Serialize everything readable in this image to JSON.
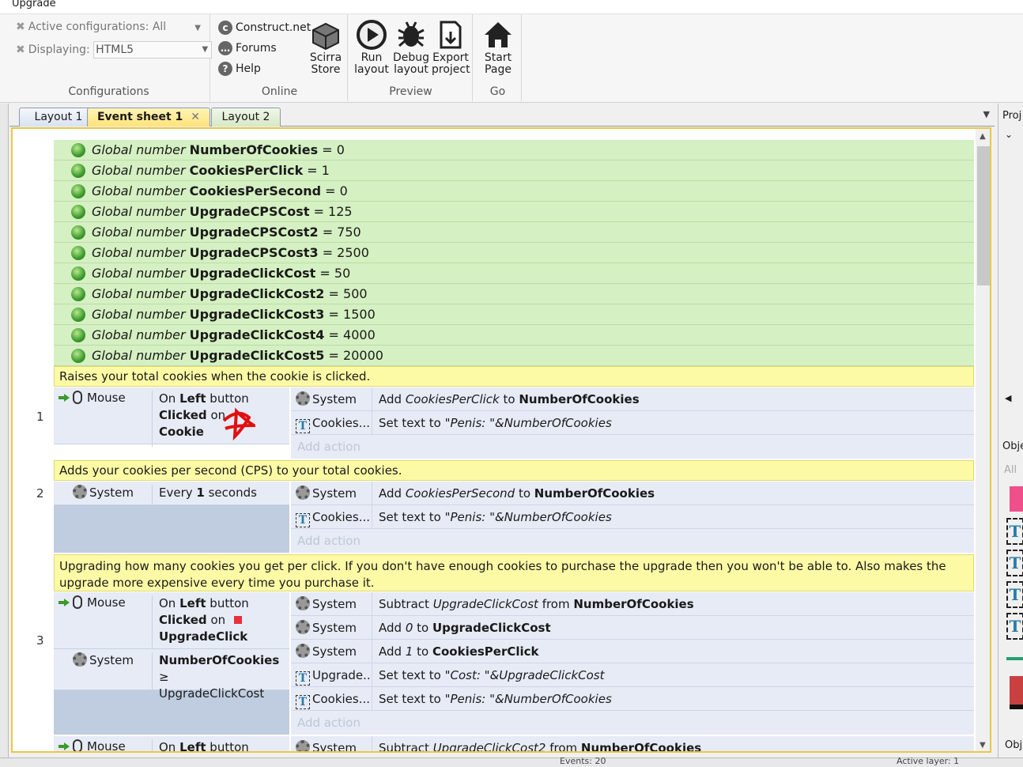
{
  "window": {
    "title": "Upgrade"
  },
  "ribbon": {
    "configurations": {
      "active_label": "Active configurations: All",
      "displaying_label": "Displaying:",
      "displaying_value": "HTML5",
      "group_label": "Configurations"
    },
    "online": {
      "construct": "Construct.net",
      "forums": "Forums",
      "help": "Help",
      "store_l1": "Scirra",
      "store_l2": "Store",
      "group_label": "Online"
    },
    "preview": {
      "run_l1": "Run",
      "run_l2": "layout",
      "debug_l1": "Debug",
      "debug_l2": "layout",
      "export_l1": "Export",
      "export_l2": "project",
      "group_label": "Preview"
    },
    "go": {
      "start_l1": "Start",
      "start_l2": "Page",
      "group_label": "Go"
    }
  },
  "tabs": {
    "layout1": "Layout 1",
    "event": "Event sheet 1",
    "close": "✕",
    "layout2": "Layout 2"
  },
  "globals": [
    {
      "kw": "Global number",
      "name": "NumberOfCookies",
      "value": "= 0"
    },
    {
      "kw": "Global number",
      "name": "CookiesPerClick",
      "value": "= 1"
    },
    {
      "kw": "Global number",
      "name": "CookiesPerSecond",
      "value": "= 0"
    },
    {
      "kw": "Global number",
      "name": "UpgradeCPSCost",
      "value": "= 125"
    },
    {
      "kw": "Global number",
      "name": "UpgradeCPSCost2",
      "value": "= 750"
    },
    {
      "kw": "Global number",
      "name": "UpgradeCPSCost3",
      "value": "= 2500"
    },
    {
      "kw": "Global number",
      "name": "UpgradeClickCost",
      "value": "= 50"
    },
    {
      "kw": "Global number",
      "name": "UpgradeClickCost2",
      "value": "= 500"
    },
    {
      "kw": "Global number",
      "name": "UpgradeClickCost3",
      "value": "= 1500"
    },
    {
      "kw": "Global number",
      "name": "UpgradeClickCost4",
      "value": "= 4000"
    },
    {
      "kw": "Global number",
      "name": "UpgradeClickCost5",
      "value": "= 20000"
    }
  ],
  "events": {
    "c1": "Raises your total cookies when the cookie is clicked.",
    "e1": {
      "num": "1",
      "cond_obj": "Mouse",
      "cond_a": "On ",
      "cond_b": "Left",
      "cond_c": " button",
      "cond_d": "Clicked",
      "cond_e": " on ",
      "cond_f": "Cookie",
      "a1_obj": "System",
      "a1_p1": "Add ",
      "a1_p2": "CookiesPerClick",
      "a1_p3": " to ",
      "a1_p4": "NumberOfCookies",
      "a2_obj": "Cookies...",
      "a2_p1": "Set text to ",
      "a2_p2": "\"Penis: \"&NumberOfCookies",
      "add": "Add action"
    },
    "c2": "Adds your cookies per second (CPS) to your total cookies.",
    "e2": {
      "num": "2",
      "cond_obj": "System",
      "cond_a": "Every ",
      "cond_b": "1",
      "cond_c": " seconds",
      "a1_obj": "System",
      "a1_p1": "Add ",
      "a1_p2": "CookiesPerSecond",
      "a1_p3": " to ",
      "a1_p4": "NumberOfCookies",
      "a2_obj": "Cookies...",
      "a2_p1": "Set text to ",
      "a2_p2": "\"Penis: \"&NumberOfCookies",
      "add": "Add action"
    },
    "c3": "Upgrading how many cookies you get per click. If you don't have enough cookies to purchase the upgrade then you won't be able to. Also makes the upgrade more expensive every time you purchase it.",
    "e3": {
      "num": "3",
      "cond1_obj": "Mouse",
      "cond1_a": "On ",
      "cond1_b": "Left",
      "cond1_c": " button",
      "cond1_d": "Clicked",
      "cond1_e": " on ",
      "cond1_f": "UpgradeClick",
      "cond2_obj": "System",
      "cond2_a": "NumberOfCookies",
      "cond2_b": " ≥",
      "cond2_c": "UpgradeClickCost",
      "a1_obj": "System",
      "a1_p1": "Subtract ",
      "a1_p2": "UpgradeClickCost",
      "a1_p3": " from ",
      "a1_p4": "NumberOfCookies",
      "a2_obj": "System",
      "a2_p1": "Add ",
      "a2_p2": "0",
      "a2_p3": " to ",
      "a2_p4": "UpgradeClickCost",
      "a3_obj": "System",
      "a3_p1": "Add ",
      "a3_p2": "1",
      "a3_p3": " to ",
      "a3_p4": "CookiesPerClick",
      "a4_obj": "Upgrade...",
      "a4_p1": "Set text to ",
      "a4_p2": "\"Cost: \"&UpgradeClickCost",
      "a5_obj": "Cookies...",
      "a5_p1": "Set text to ",
      "a5_p2": "\"Penis: \"&NumberOfCookies",
      "add": "Add action"
    },
    "e4": {
      "cond_obj": "Mouse",
      "cond_a": "On ",
      "cond_b": "Left",
      "cond_c": " button",
      "a1_obj": "System",
      "a1_p1": "Subtract ",
      "a1_p2": "UpgradeClickCost2",
      "a1_p3": " from ",
      "a1_p4": "NumberOfCookies"
    }
  },
  "right_panel": {
    "projects": "Proj",
    "objects": "Obje",
    "all": "All",
    "obj_bottom": "Obj"
  },
  "status": {
    "events": "Events: 20",
    "active": "Active layer: 1"
  }
}
